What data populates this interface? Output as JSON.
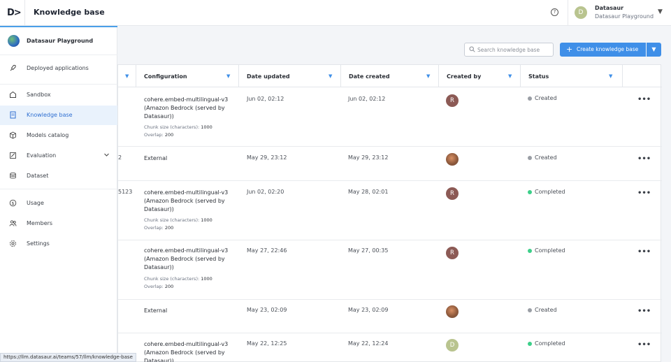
{
  "header": {
    "logo_text": "D>",
    "title": "Knowledge base",
    "help_icon": "question-circle-icon",
    "user": {
      "initial": "D",
      "name": "Datasaur",
      "team": "Datasaur Playground"
    }
  },
  "sidebar": {
    "team_name": "Datasaur Playground",
    "items": [
      {
        "label": "Deployed applications",
        "icon": "rocket-icon"
      },
      {
        "label": "Sandbox",
        "icon": "sandbox-icon"
      },
      {
        "label": "Knowledge base",
        "icon": "document-icon",
        "active": true
      },
      {
        "label": "Models catalog",
        "icon": "cube-icon"
      },
      {
        "label": "Evaluation",
        "icon": "evaluation-icon"
      },
      {
        "label": "Dataset",
        "icon": "stack-icon"
      },
      {
        "label": "Usage",
        "icon": "dollar-icon"
      },
      {
        "label": "Members",
        "icon": "people-icon"
      },
      {
        "label": "Settings",
        "icon": "gear-icon"
      }
    ]
  },
  "toolbar": {
    "search_placeholder": "Search knowledge base",
    "create_label": "Create knowledge base"
  },
  "table": {
    "columns": [
      "Configuration",
      "Date updated",
      "Date created",
      "Created by",
      "Status"
    ],
    "rows": [
      {
        "name_fragment": "",
        "config": "cohere.embed-multilingual-v3 (Amazon Bedrock (served by Datasaur))",
        "chunk_label": "Chunk size (characters):",
        "chunk": "1000",
        "overlap_label": "Overlap:",
        "overlap": "200",
        "updated": "Jun 02, 02:12",
        "created": "Jun 02, 02:12",
        "by": "R",
        "status": "Created"
      },
      {
        "name_fragment": "2",
        "config": "External",
        "updated": "May 29, 23:12",
        "created": "May 29, 23:12",
        "by": "photo",
        "status": "Created"
      },
      {
        "name_fragment": "5123",
        "config": "cohere.embed-multilingual-v3 (Amazon Bedrock (served by Datasaur))",
        "chunk_label": "Chunk size (characters):",
        "chunk": "1000",
        "overlap_label": "Overlap:",
        "overlap": "200",
        "updated": "Jun 02, 02:20",
        "created": "May 28, 02:01",
        "by": "R",
        "status": "Completed"
      },
      {
        "name_fragment": "",
        "config": "cohere.embed-multilingual-v3 (Amazon Bedrock (served by Datasaur))",
        "chunk_label": "Chunk size (characters):",
        "chunk": "1000",
        "overlap_label": "Overlap:",
        "overlap": "200",
        "updated": "May 27, 22:46",
        "created": "May 27, 00:35",
        "by": "R",
        "status": "Completed"
      },
      {
        "name_fragment": "",
        "config": "External",
        "updated": "May 23, 02:09",
        "created": "May 23, 02:09",
        "by": "photo",
        "status": "Created"
      },
      {
        "name_fragment": "",
        "config": "cohere.embed-multilingual-v3 (Amazon Bedrock (served by Datasaur))",
        "updated": "May 22, 12:25",
        "created": "May 22, 12:24",
        "by": "D",
        "status": "Completed"
      }
    ],
    "more_label": "•••"
  },
  "status_url": "https://llm.datasaur.ai/teams/57/llm/knowledge-base"
}
